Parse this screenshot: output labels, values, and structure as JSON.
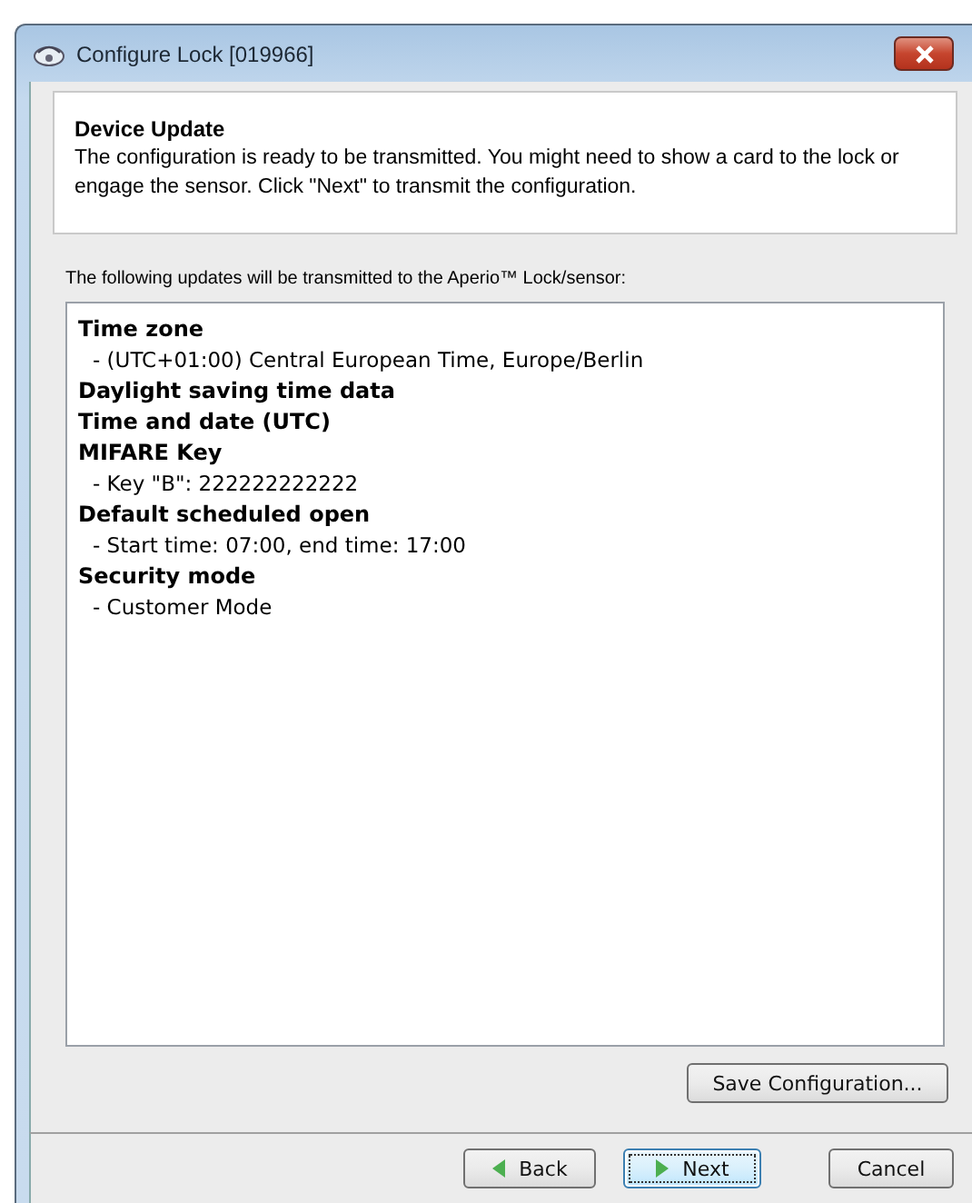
{
  "window": {
    "title": "Configure Lock [019966]"
  },
  "header": {
    "title": "Device Update",
    "text": "The configuration is ready to be transmitted. You might need to show a card to the lock or engage the sensor. Click \"Next\" to transmit the configuration."
  },
  "updates_label": "The following updates will be transmitted to the Aperio™ Lock/sensor:",
  "updates": [
    {
      "name": "Time zone",
      "details": [
        "- (UTC+01:00) Central European Time, Europe/Berlin"
      ]
    },
    {
      "name": "Daylight saving time data"
    },
    {
      "name": "Time and date (UTC)"
    },
    {
      "name": "MIFARE Key",
      "details": [
        "- Key \"B\": 222222222222"
      ]
    },
    {
      "name": "Default scheduled open",
      "details": [
        "- Start time: 07:00, end time: 17:00"
      ]
    },
    {
      "name": "Security mode",
      "details": [
        "- Customer Mode"
      ]
    }
  ],
  "save_button": "Save Configuration...",
  "buttons": [
    {
      "label": "Back",
      "kind": "back",
      "default": false
    },
    {
      "label": "Next",
      "kind": "next",
      "default": true
    },
    {
      "label": "Cancel",
      "kind": "plain",
      "default": false
    }
  ]
}
